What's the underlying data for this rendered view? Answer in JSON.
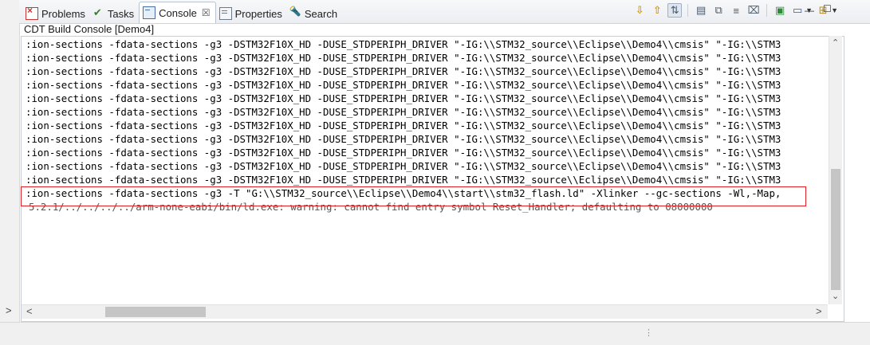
{
  "tabs": [
    {
      "label": "Problems",
      "icon": "problems-icon",
      "active": false
    },
    {
      "label": "Tasks",
      "icon": "tasks-icon",
      "active": false
    },
    {
      "label": "Console",
      "icon": "console-icon",
      "active": true,
      "close": "☒"
    },
    {
      "label": "Properties",
      "icon": "properties-icon",
      "active": false
    },
    {
      "label": "Search",
      "icon": "search-icon",
      "active": false
    }
  ],
  "toolbar": {
    "icons": [
      "scroll-down-icon",
      "scroll-up-icon",
      "scroll-lock-icon",
      "pin-console-icon",
      "copy-icon",
      "word-wrap-icon",
      "clear-console-icon",
      "open-console-icon",
      "display-console-icon",
      "new-console-icon"
    ],
    "minimize": "—",
    "maximize": "☐"
  },
  "console": {
    "title": "CDT Build Console [Demo4]",
    "lines": [
      ":ion-sections -fdata-sections -g3 -DSTM32F10X_HD -DUSE_STDPERIPH_DRIVER \"-IG:\\\\STM32_source\\\\Eclipse\\\\Demo4\\\\cmsis\" \"-IG:\\\\STM3",
      ":ion-sections -fdata-sections -g3 -DSTM32F10X_HD -DUSE_STDPERIPH_DRIVER \"-IG:\\\\STM32_source\\\\Eclipse\\\\Demo4\\\\cmsis\" \"-IG:\\\\STM3",
      ":ion-sections -fdata-sections -g3 -DSTM32F10X_HD -DUSE_STDPERIPH_DRIVER \"-IG:\\\\STM32_source\\\\Eclipse\\\\Demo4\\\\cmsis\" \"-IG:\\\\STM3",
      ":ion-sections -fdata-sections -g3 -DSTM32F10X_HD -DUSE_STDPERIPH_DRIVER \"-IG:\\\\STM32_source\\\\Eclipse\\\\Demo4\\\\cmsis\" \"-IG:\\\\STM3",
      ":ion-sections -fdata-sections -g3 -DSTM32F10X_HD -DUSE_STDPERIPH_DRIVER \"-IG:\\\\STM32_source\\\\Eclipse\\\\Demo4\\\\cmsis\" \"-IG:\\\\STM3",
      ":ion-sections -fdata-sections -g3 -DSTM32F10X_HD -DUSE_STDPERIPH_DRIVER \"-IG:\\\\STM32_source\\\\Eclipse\\\\Demo4\\\\cmsis\" \"-IG:\\\\STM3",
      ":ion-sections -fdata-sections -g3 -DSTM32F10X_HD -DUSE_STDPERIPH_DRIVER \"-IG:\\\\STM32_source\\\\Eclipse\\\\Demo4\\\\cmsis\" \"-IG:\\\\STM3",
      ":ion-sections -fdata-sections -g3 -DSTM32F10X_HD -DUSE_STDPERIPH_DRIVER \"-IG:\\\\STM32_source\\\\Eclipse\\\\Demo4\\\\cmsis\" \"-IG:\\\\STM3",
      ":ion-sections -fdata-sections -g3 -DSTM32F10X_HD -DUSE_STDPERIPH_DRIVER \"-IG:\\\\STM32_source\\\\Eclipse\\\\Demo4\\\\cmsis\" \"-IG:\\\\STM3",
      ":ion-sections -fdata-sections -g3 -DSTM32F10X_HD -DUSE_STDPERIPH_DRIVER \"-IG:\\\\STM32_source\\\\Eclipse\\\\Demo4\\\\cmsis\" \"-IG:\\\\STM3",
      ":ion-sections -fdata-sections -g3 -DSTM32F10X_HD -DUSE_STDPERIPH_DRIVER \"-IG:\\\\STM32_source\\\\Eclipse\\\\Demo4\\\\cmsis\" \"-IG:\\\\STM3",
      ":ion-sections -fdata-sections -g3 -T \"G:\\\\STM32_source\\\\Eclipse\\\\Demo4\\\\start\\\\stm32_flash.ld\" -Xlinker --gc-sections -Wl,-Map,",
      "5.2.1/../../../../arm-none-eabi/bin/ld.exe: warning: cannot find entry symbol Reset_Handler; defaulting to 08000000"
    ],
    "warning_line_index": 12
  },
  "scrollbars": {
    "vertical": {
      "up": "⌃",
      "down": "⌄"
    },
    "horizontal": {
      "left": "<",
      "right": ">"
    }
  },
  "gutter_arrow": ">",
  "colors": {
    "highlight_border": "#e02020"
  }
}
